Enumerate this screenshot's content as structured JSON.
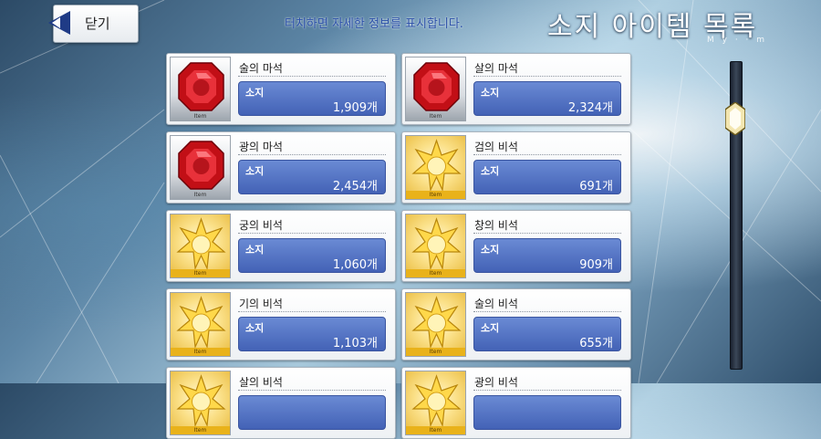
{
  "header": {
    "back_label": "닫기",
    "hint": "터치하면 자세한 정보를 표시합니다.",
    "title": "소지 아이템 목록",
    "subcaption": "M y · · m"
  },
  "colors": {
    "accent_blue": "#4362b6",
    "gold": "#e9b21a",
    "ruby": "#d0121b"
  },
  "items": [
    {
      "name": "술의 마석",
      "owned_label": "소지",
      "count": "1,909개",
      "kind": "magic-gem",
      "frame": "silver",
      "thumb_label": "Item"
    },
    {
      "name": "살의 마석",
      "owned_label": "소지",
      "count": "2,324개",
      "kind": "magic-gem",
      "frame": "silver",
      "thumb_label": "Item"
    },
    {
      "name": "광의 마석",
      "owned_label": "소지",
      "count": "2,454개",
      "kind": "magic-gem",
      "frame": "silver",
      "thumb_label": "Item"
    },
    {
      "name": "검의 비석",
      "owned_label": "소지",
      "count": "691개",
      "kind": "secret-gem",
      "frame": "gold",
      "thumb_label": "Item"
    },
    {
      "name": "궁의 비석",
      "owned_label": "소지",
      "count": "1,060개",
      "kind": "secret-gem",
      "frame": "gold",
      "thumb_label": "Item"
    },
    {
      "name": "창의 비석",
      "owned_label": "소지",
      "count": "909개",
      "kind": "secret-gem",
      "frame": "gold",
      "thumb_label": "Item"
    },
    {
      "name": "기의 비석",
      "owned_label": "소지",
      "count": "1,103개",
      "kind": "secret-gem",
      "frame": "gold",
      "thumb_label": "Item"
    },
    {
      "name": "술의 비석",
      "owned_label": "소지",
      "count": "655개",
      "kind": "secret-gem",
      "frame": "gold",
      "thumb_label": "Item"
    },
    {
      "name": "살의 비석",
      "owned_label": "",
      "count": "",
      "kind": "secret-gem",
      "frame": "gold",
      "thumb_label": "Item"
    },
    {
      "name": "광의 비석",
      "owned_label": "",
      "count": "",
      "kind": "secret-gem",
      "frame": "gold",
      "thumb_label": "Item"
    }
  ],
  "scroll": {
    "position": 0.15
  }
}
